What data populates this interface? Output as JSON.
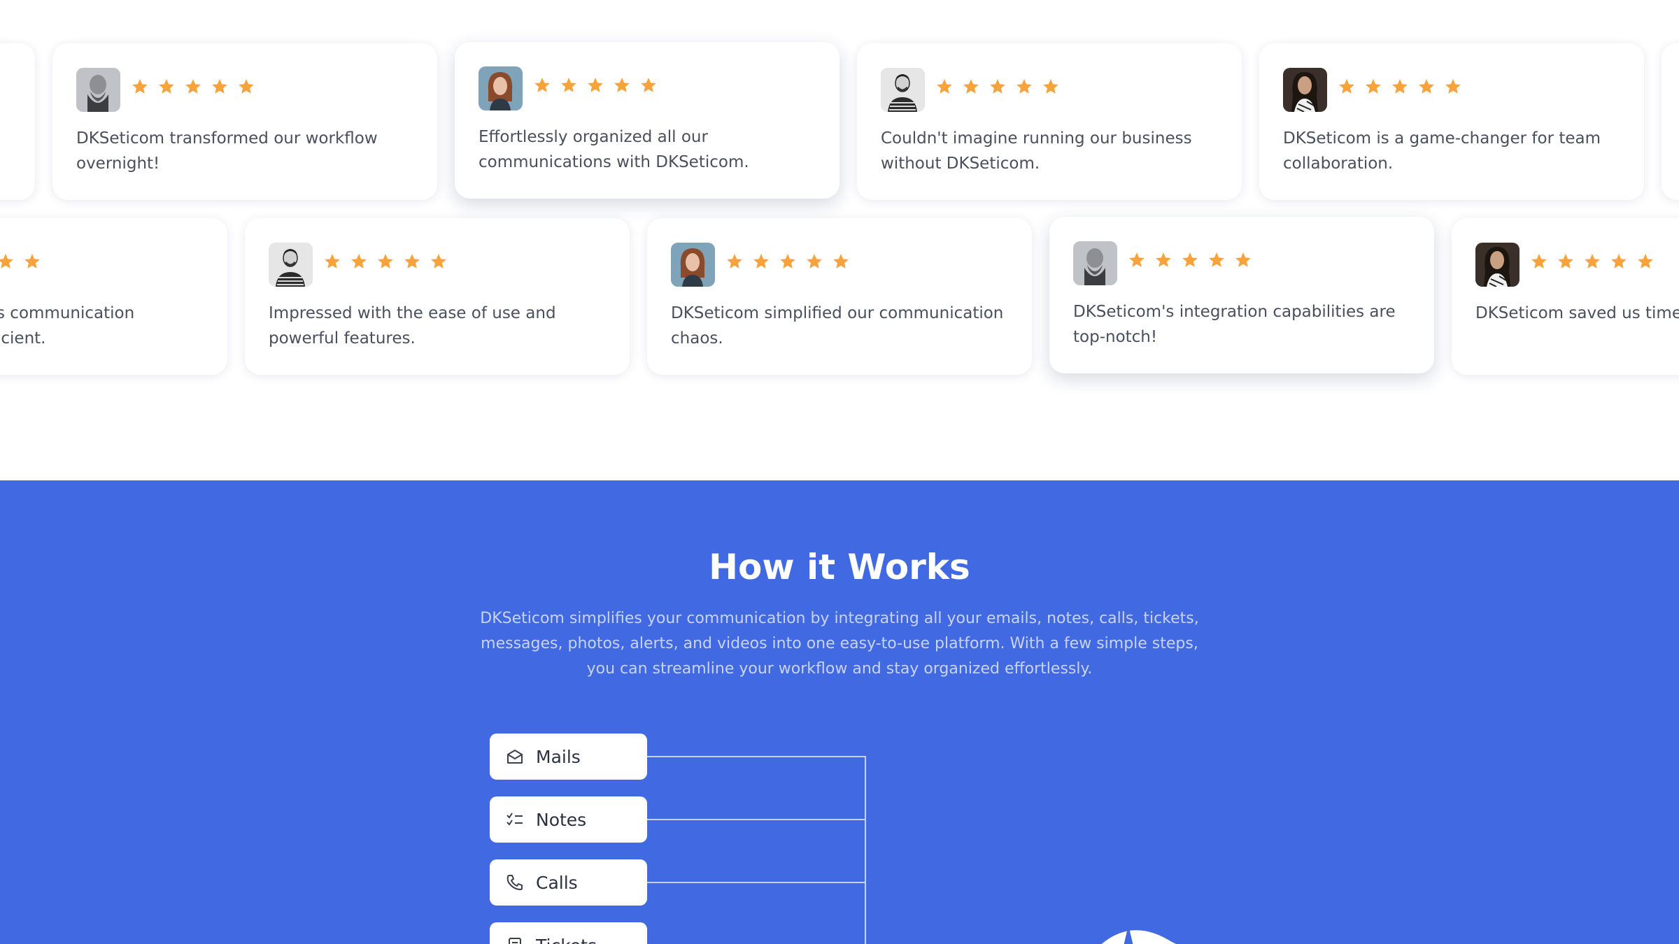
{
  "testimonials": {
    "row1": [
      {
        "quote": "",
        "avatar": "partial",
        "rating": 5
      },
      {
        "quote": "DKSeticom transformed our workflow overnight!",
        "avatar": "bearded-man-avatar",
        "rating": 5
      },
      {
        "quote": "Effortlessly organized all our communications with DKSeticom.",
        "avatar": "red-haired-woman-avatar",
        "rating": 5
      },
      {
        "quote": "Couldn't imagine running our business without DKSeticom.",
        "avatar": "man-striped-sweater-avatar",
        "rating": 5
      },
      {
        "quote": "DKSeticom is a game-changer for team collaboration.",
        "avatar": "dark-haired-woman-avatar",
        "rating": 5
      }
    ],
    "row2": [
      {
        "quote": "s communication icient.",
        "avatar": "none",
        "rating": 5
      },
      {
        "quote": "Impressed with the ease of use and powerful features.",
        "avatar": "man-striped-sweater-avatar",
        "rating": 5
      },
      {
        "quote": "DKSeticom simplified our communication chaos.",
        "avatar": "red-haired-woman-avatar",
        "rating": 5
      },
      {
        "quote": "DKSeticom's integration capabilities are top-notch!",
        "avatar": "bearded-man-avatar",
        "rating": 5
      },
      {
        "quote": "DKSeticom saved us time our efficiency.",
        "avatar": "dark-haired-woman-avatar",
        "rating": 5
      }
    ],
    "star_color": "#f7a23b"
  },
  "how_it_works": {
    "title": "How it Works",
    "description": "DKSeticom simplifies your communication by integrating all your emails, notes, calls, tickets, messages, photos, alerts, and videos into one easy-to-use platform. With a few simple steps, you can streamline your workflow and stay organized effortlessly.",
    "background_color": "#4169e1",
    "items": [
      {
        "label": "Mails",
        "icon": "envelope-icon"
      },
      {
        "label": "Notes",
        "icon": "checklist-icon"
      },
      {
        "label": "Calls",
        "icon": "phone-icon"
      },
      {
        "label": "Tickets",
        "icon": "ticket-icon"
      }
    ]
  }
}
